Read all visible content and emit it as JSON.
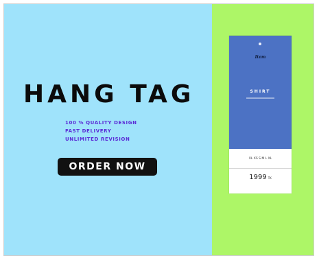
{
  "headline": "HANG TAG",
  "features": [
    "100 % QUALITY DESIGN",
    "FAST DELIVERY",
    "UNLIMITED REVISION"
  ],
  "cta": "ORDER NOW",
  "tag_mockup": {
    "brand": "Item",
    "product": "SHIRT",
    "size_line": "XL  XS  S  M  L  XL",
    "price": "1999",
    "currency": "TK"
  },
  "colors": {
    "left_background": "#9fe3fb",
    "right_background": "#adf667",
    "headline": "#0b0b0b",
    "features_text": "#5a2bd6",
    "button_background": "#111111",
    "tag_top": "#4c72c4"
  }
}
